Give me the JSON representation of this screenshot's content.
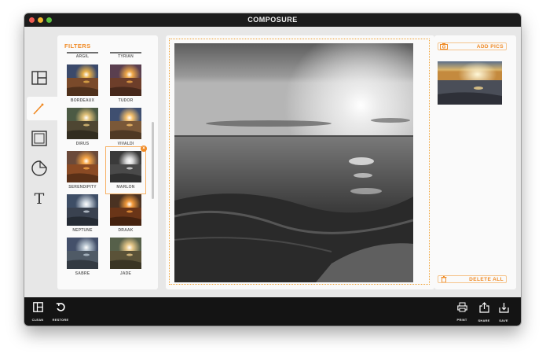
{
  "window": {
    "title": "COMPOSURE"
  },
  "tools": [
    {
      "name": "layout-tool",
      "icon": "layout-icon"
    },
    {
      "name": "filter-tool",
      "icon": "magic-wand-icon",
      "active": true
    },
    {
      "name": "frame-tool",
      "icon": "frame-icon"
    },
    {
      "name": "sticker-tool",
      "icon": "sticker-icon"
    },
    {
      "name": "text-tool",
      "icon": "text-icon",
      "glyph": "T"
    }
  ],
  "filters": {
    "title": "FILTERS",
    "top_items": [
      "ARGIL",
      "TYRIAN"
    ],
    "items": [
      {
        "label": "BORDEAUX"
      },
      {
        "label": "TUDOR"
      },
      {
        "label": "DIRUS"
      },
      {
        "label": "VIVALDI"
      },
      {
        "label": "SERENDIPITY"
      },
      {
        "label": "MARLON",
        "selected": true,
        "badge": "×"
      },
      {
        "label": "NEPTUNE"
      },
      {
        "label": "DRAAK"
      },
      {
        "label": "SABRE"
      },
      {
        "label": "JADE"
      }
    ]
  },
  "pics": {
    "add_label": "ADD PICS",
    "delete_label": "DELETE ALL"
  },
  "bottom_bar": {
    "clean": "CLEAN",
    "restore": "RESTORE",
    "print": "PRINT",
    "share": "SHARE",
    "save": "SAVE"
  },
  "colors": {
    "accent": "#f08a24",
    "titlebar": "#1c1c1c",
    "bottombar": "#141414"
  }
}
